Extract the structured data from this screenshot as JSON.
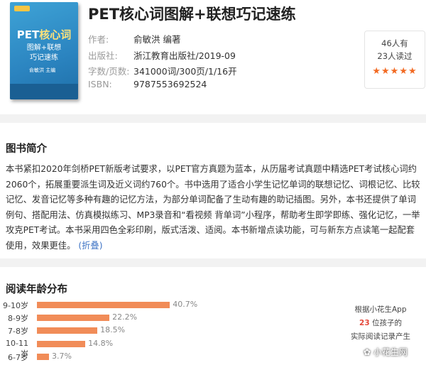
{
  "book": {
    "title": "PET核心词图解+联想巧记速练",
    "cover": {
      "title_main": "PET",
      "title_accent": "核心词",
      "subtitle_1": "图解+联想",
      "subtitle_2": "巧记速练",
      "author": "俞敏洪 主编"
    },
    "meta": [
      {
        "label": "作者:",
        "value": "俞敏洪 编著"
      },
      {
        "label": "出版社:",
        "value": "浙江教育出版社/2019-09"
      },
      {
        "label": "字数/页数:",
        "value": "341000词/300页/1/16开"
      },
      {
        "label": "ISBN:",
        "value": "9787553692524"
      }
    ]
  },
  "rating": {
    "wanted": "46人有",
    "read": "23人读过",
    "stars": "★★★★★",
    "star_color": "#f26b24"
  },
  "intro": {
    "heading": "图书简介",
    "text": "本书紧扣2020年剑桥PET新版考试要求，以PET官方真题为蓝本，从历届考试真题中精选PET考试核心词约2060个，拓展重要派生词及近义词约760个。书中选用了适合小学生记忆单词的联想记忆、词根记忆、比较记忆、发音记忆等多种有趣的记忆方法，为部分单词配备了生动有趣的助记插图。另外，本书还提供了单词例句、搭配用法、仿真模拟练习、MP3录音和“看视频 背单词”小程序，帮助考生即学即练、强化记忆，一举攻克PET考试。本书采用四色全彩印刷，版式活泼、适阅。本书新增点读功能，可与新东方点读笔一起配套使用，效果更佳。",
    "fold_link": "(折叠)"
  },
  "age": {
    "heading": "阅读年龄分布",
    "side_line1": "根据小花生App",
    "side_count": "23",
    "side_line2": " 位孩子的",
    "side_line3": "实际阅读记录产生"
  },
  "chart_data": {
    "type": "bar",
    "orientation": "horizontal",
    "categories": [
      "9-10岁",
      "8-9岁",
      "7-8岁",
      "10-11岁",
      "6-7岁"
    ],
    "values": [
      40.7,
      22.2,
      18.5,
      14.8,
      3.7
    ],
    "labels": [
      "40.7%",
      "22.2%",
      "18.5%",
      "14.8%",
      "3.7%"
    ],
    "unit": "%",
    "bar_color": "#f18c58"
  },
  "watermark": "小花生网",
  "colors": {
    "accent_orange": "#f18c58",
    "link_blue": "#3f74c5",
    "highlight_red": "#e5483a",
    "cover_blue": "#2b84c0"
  }
}
